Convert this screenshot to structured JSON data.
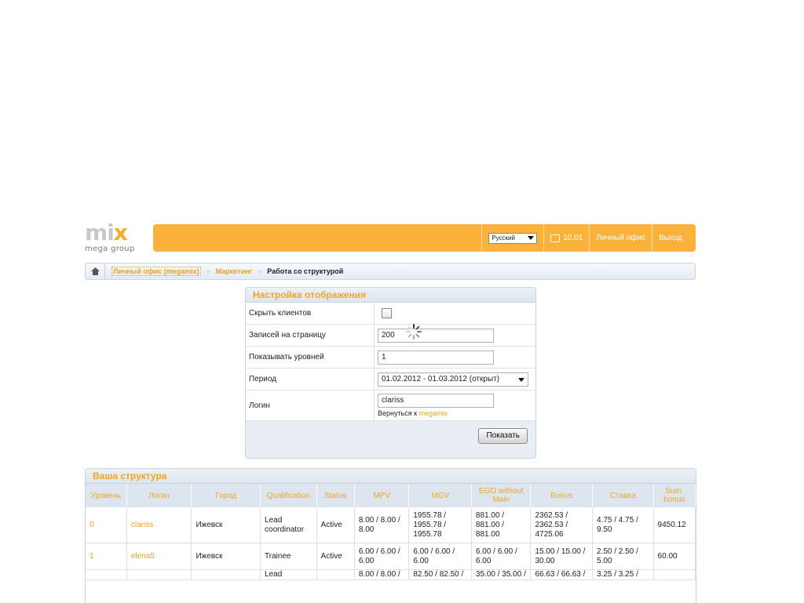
{
  "logo": {
    "letters": [
      "m",
      "i"
    ],
    "x_letter": "x",
    "subtitle": "mega group"
  },
  "topbar": {
    "language": "Русский",
    "balance": "10,01",
    "office_link": "Личный офис",
    "logout_link": "Выход"
  },
  "breadcrumb": {
    "items": [
      "Личный офис (megamix)",
      "Маркетинг"
    ],
    "current": "Работа со структурой"
  },
  "settings": {
    "title": "Настройка отображения",
    "rows": [
      {
        "label": "Скрыть клиентов"
      },
      {
        "label": "Записей на страницу",
        "value": "200"
      },
      {
        "label": "Показывать уровней",
        "value": "1"
      },
      {
        "label": "Период",
        "value": "01.02.2012 - 01.03.2012 (открыт)"
      },
      {
        "label": "Логин",
        "value": "clariss"
      }
    ],
    "back_text": "Вернуться к",
    "back_link": "megamix",
    "button": "Показать"
  },
  "structure": {
    "title": "Ваша структура",
    "columns": [
      "Уровень",
      "Логин",
      "Город",
      "Qualification",
      "Status",
      "MPV",
      "MGV",
      "EGO without Main",
      "Bonus",
      "Ставка",
      "Sum. bonus"
    ],
    "rows": [
      [
        "0",
        "clariss",
        "Ижевск",
        "Lead coordinator",
        "Active",
        "8.00 / 8.00 / 8.00",
        "1955.78 / 1955.78 / 1955.78",
        "881.00 / 881.00 / 881.00",
        "2362.53 / 2362.53 / 4725.06",
        "4.75 / 4.75 / 9.50",
        "9450.12"
      ],
      [
        "1",
        "elena5",
        "Ижевск",
        "Trainee",
        "Active",
        "6.00 / 6.00 / 6.00",
        "6.00 / 6.00 / 6.00",
        "6.00 / 6.00 / 6.00",
        "15.00 / 15.00 / 30.00",
        "2.50 / 2.50 / 5.00",
        "60.00"
      ],
      [
        "",
        "",
        "",
        "Lead",
        "",
        "8.00 / 8.00 /",
        "82.50 / 82.50 /",
        "35.00 / 35.00 /",
        "66.63 / 66.63 /",
        "3.25 / 3.25 /",
        ""
      ]
    ]
  }
}
